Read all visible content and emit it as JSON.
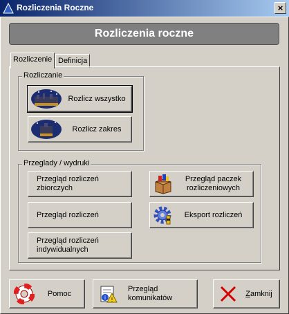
{
  "window": {
    "title": "Rozliczenia Roczne",
    "close_glyph": "×"
  },
  "header": {
    "title": "Rozliczenia roczne"
  },
  "tabs": [
    {
      "label": "Rozliczenie"
    },
    {
      "label": "Definicja"
    }
  ],
  "group_rozliczanie": {
    "label": "Rozliczanie",
    "buttons": [
      {
        "label": "Rozlicz wszystko",
        "icon": "night-city-icon"
      },
      {
        "label": "Rozlicz zakres",
        "icon": "night-city-icon"
      }
    ]
  },
  "group_przeglady": {
    "label": "Przeglady / wydruki",
    "left_buttons": [
      {
        "line1": "Przegląd rozliczeń",
        "line2": "zbiorczych"
      },
      {
        "line1": "Przegląd rozliczeń",
        "line2": ""
      },
      {
        "line1": "Przegląd rozliczeń",
        "line2": "indywidualnych"
      }
    ],
    "right_buttons": [
      {
        "line1": "Przegląd paczek",
        "line2": "rozliczeniowych",
        "icon": "package-icon"
      },
      {
        "line1": "Eksport rozliczeń",
        "line2": "",
        "icon": "gear-icon"
      }
    ]
  },
  "footer": {
    "help": {
      "label": "Pomoc",
      "icon": "lifebuoy-icon"
    },
    "messages": {
      "line1": "Przegląd",
      "line2": "komunikatów",
      "icon": "messages-icon"
    },
    "close": {
      "prefix": "",
      "underlined": "Z",
      "rest": "amknij",
      "icon": "close-x-icon"
    }
  },
  "colors": {
    "titlebar_start": "#0a246a",
    "titlebar_end": "#a6caf0",
    "header_bg": "#808080",
    "close_x": "#d40000"
  }
}
